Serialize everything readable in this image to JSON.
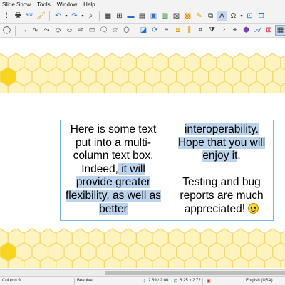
{
  "menu": [
    "Slide Show",
    "Tools",
    "Window",
    "Help"
  ],
  "toolbar1_icons": [
    "text-box-tool",
    "print-icon",
    "spellcheck-icon",
    "clone-formatting-icon",
    "undo-icon",
    "undo-dropdown-icon",
    "redo-icon",
    "redo-dropdown-icon",
    "find-replace-icon",
    "table-icon",
    "image-icon",
    "chart-icon",
    "insert-text-box-icon",
    "special-character-icon",
    "fontwork-icon",
    "gallery-icon",
    "slide-layout-icon",
    "duplicate-slide-icon",
    "show-draw-functions-icon"
  ],
  "toolbar2_icons": [
    "ellipse-icon",
    "line-arrow-icon",
    "curve-icon",
    "connector-icon",
    "basic-shapes-icon",
    "symbol-shapes-icon",
    "block-arrows-icon",
    "flowchart-icon",
    "callouts-icon",
    "stars-icon",
    "3d-objects-icon",
    "shadow-icon",
    "rotate-icon",
    "align-icon",
    "arrange-icon",
    "distribute-icon",
    "crop-icon",
    "filter-icon",
    "points-icon",
    "glue-points-icon",
    "toggle-extrusion-icon"
  ],
  "textbox": {
    "col1": {
      "plain": "Here is some text put into a multi-column text box. Indeed,",
      "highlight": " it will provide greater flexibility, as well as better"
    },
    "col2": {
      "highlight": "interoperability. Hope that you will enjoy it",
      "plain_end": ".",
      "para2": "Testing and bug reports are much appreciated!"
    }
  },
  "statusbar": {
    "column": "Column 9",
    "master": "Beehive",
    "position": "2.39 / 2.00",
    "size": "6.25 x 2.72",
    "language": "English (USA)"
  },
  "colors": {
    "hex_fill": "#fdf3bf",
    "hex_stroke": "#f5d66a",
    "hex_accent": "#f7d51e",
    "text_highlight": "#bcd3ec",
    "textbox_border": "#7fb0de"
  }
}
